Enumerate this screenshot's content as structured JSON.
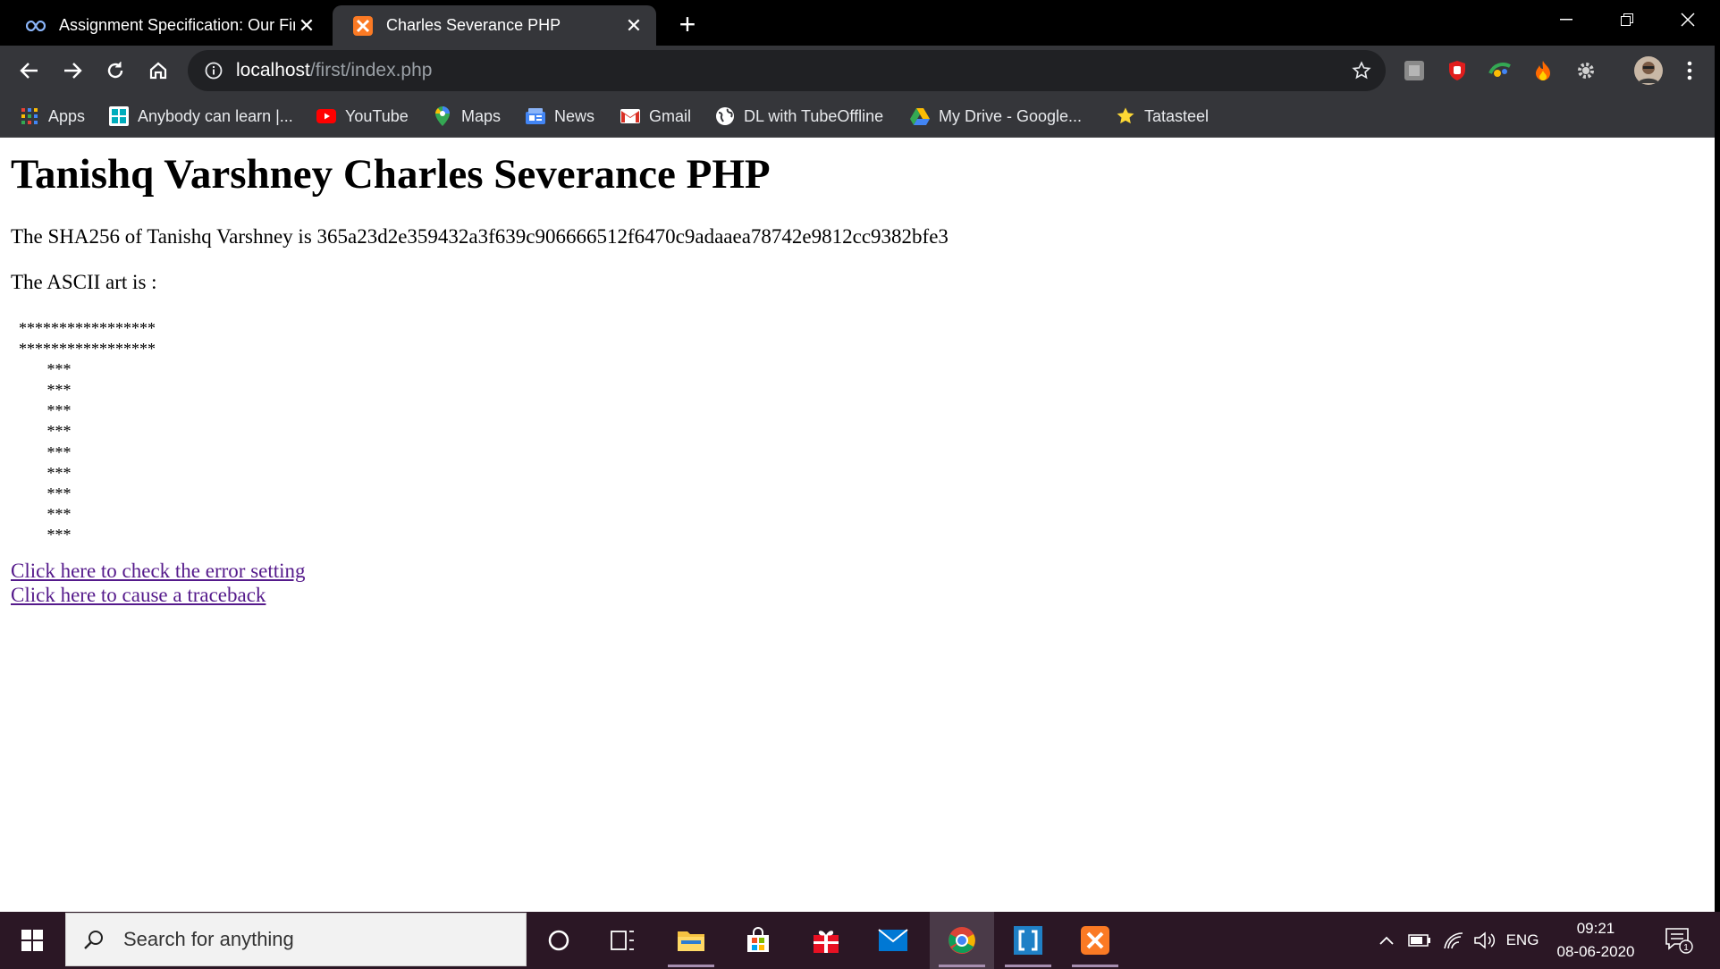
{
  "browser": {
    "tabs": [
      {
        "title": "Assignment Specification: Our Fir",
        "icon": "coursera-infinity-icon",
        "active": false
      },
      {
        "title": "Charles Severance PHP",
        "icon": "xampp-icon",
        "active": true
      }
    ],
    "address": {
      "host": "localhost",
      "path": "/first/index.php"
    },
    "bookmarks": [
      {
        "label": "Apps",
        "icon": "apps-grid-icon"
      },
      {
        "label": "Anybody can learn |...",
        "icon": "code-org-icon"
      },
      {
        "label": "YouTube",
        "icon": "youtube-icon"
      },
      {
        "label": "Maps",
        "icon": "maps-pin-icon"
      },
      {
        "label": "News",
        "icon": "news-icon"
      },
      {
        "label": "Gmail",
        "icon": "gmail-icon"
      },
      {
        "label": "DL with TubeOffline",
        "icon": "globe-icon"
      },
      {
        "label": "My Drive - Google...",
        "icon": "drive-icon"
      },
      {
        "label": "Tatasteel",
        "icon": "star-bookmark-icon"
      }
    ]
  },
  "page": {
    "heading": "Tanishq Varshney Charles Severance PHP",
    "sha_text": "The SHA256 of Tanishq Varshney is 365a23d2e359432a3f639c906666512f6470c9adaaea78742e9812cc9382bfe3",
    "ascii_label": "The ASCII art is :",
    "ascii_art": "  *****************\n  *****************\n         ***\n         ***\n         ***\n         ***\n         ***\n         ***\n         ***\n         ***\n         ***",
    "links": [
      "Click here to check the error setting",
      "Click here to cause a traceback"
    ]
  },
  "taskbar": {
    "search_placeholder": "Search for anything",
    "language": "ENG",
    "time": "09:21",
    "date": "08-06-2020",
    "notification_count": "1"
  },
  "colors": {
    "tab_strip": "#000000",
    "toolbar": "#35363a",
    "omnibox": "#202124",
    "visited_link": "#551a8b",
    "taskbar": "#2b1725"
  }
}
